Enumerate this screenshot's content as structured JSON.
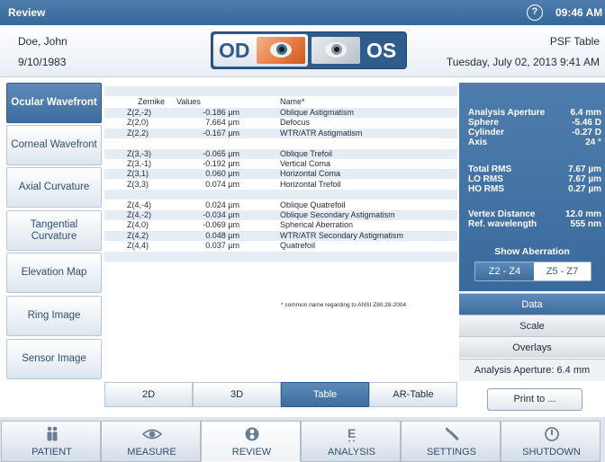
{
  "titlebar": {
    "title": "Review",
    "help_glyph": "?",
    "time": "09:46 AM"
  },
  "patient": {
    "name": "Doe, John",
    "dob": "9/10/1983"
  },
  "eye_selector": {
    "od": "OD",
    "os": "OS",
    "selected": "OD"
  },
  "view": {
    "name": "PSF Table",
    "timestamp": "Tuesday, July 02, 2013 9:41 AM"
  },
  "left_nav": {
    "active": "Ocular Wavefront",
    "items": [
      {
        "label": "Ocular Wavefront"
      },
      {
        "label": "Corneal Wavefront"
      },
      {
        "label": "Axial Curvature"
      },
      {
        "label": "Tangential Curvature"
      },
      {
        "label": "Elevation Map"
      },
      {
        "label": "Ring Image"
      },
      {
        "label": "Sensor Image"
      }
    ]
  },
  "table": {
    "headers": [
      "Zernike",
      "Values",
      "Name*"
    ],
    "rows": [
      [
        "Z(2,-2)",
        "-0.186 µm",
        "Oblique Astigmatism"
      ],
      [
        "Z(2,0)",
        "7.664 µm",
        "Defocus"
      ],
      [
        "Z(2,2)",
        "-0.167 µm",
        "WTR/ATR Astigmatism"
      ],
      [
        "",
        "",
        ""
      ],
      [
        "Z(3,-3)",
        "-0.065 µm",
        "Oblique Trefoil"
      ],
      [
        "Z(3,-1)",
        "-0.192 µm",
        "Vertical Coma"
      ],
      [
        "Z(3,1)",
        "0.060 µm",
        "Horizontal Coma"
      ],
      [
        "Z(3,3)",
        "0.074 µm",
        "Horizontal Trefoil"
      ],
      [
        "",
        "",
        ""
      ],
      [
        "Z(4,-4)",
        "0.024 µm",
        "Oblique Quatrefoil"
      ],
      [
        "Z(4,-2)",
        "-0.034 µm",
        "Oblique Secondary Astigmatism"
      ],
      [
        "Z(4,0)",
        "-0.069 µm",
        "Spherical Aberration"
      ],
      [
        "Z(4,2)",
        "0.048 µm",
        "WTR/ATR Secondary Astigmatism"
      ],
      [
        "Z(4,4)",
        "0.037 µm",
        "Quatrefoil"
      ]
    ],
    "footnote": "* common name regarding to ANSI Z80.28-2004"
  },
  "summary": {
    "group1": [
      {
        "k": "Analysis Aperture",
        "v": "6.4 mm"
      },
      {
        "k": "Sphere",
        "v": "-5.46 D"
      },
      {
        "k": "Cylinder",
        "v": "-0.27 D"
      },
      {
        "k": "Axis",
        "v": "24 °"
      }
    ],
    "group2": [
      {
        "k": "Total RMS",
        "v": "7.67 µm"
      },
      {
        "k": "LO RMS",
        "v": "7.67 µm"
      },
      {
        "k": "HO RMS",
        "v": "0.27 µm"
      }
    ],
    "group3": [
      {
        "k": "Vertex Distance",
        "v": "12.0 mm"
      },
      {
        "k": "Ref. wavelength",
        "v": "555 nm"
      }
    ],
    "show_aberration": "Show Aberration",
    "ranges": [
      "Z2 - Z4",
      "Z5 - Z7"
    ],
    "range_selected": "Z2 - Z4"
  },
  "right_buttons": {
    "data": "Data",
    "scale": "Scale",
    "overlays": "Overlays"
  },
  "aperture_footer": "Analysis Aperture: 6.4 mm",
  "view_tabs": {
    "items": [
      "2D",
      "3D",
      "Table",
      "AR-Table"
    ],
    "active": "Table"
  },
  "print_button": "Print to ...",
  "footer": {
    "active": "REVIEW",
    "items": [
      {
        "label": "PATIENT",
        "icon": "patient-icon"
      },
      {
        "label": "MEASURE",
        "icon": "eye-icon"
      },
      {
        "label": "REVIEW",
        "icon": "review-icon"
      },
      {
        "label": "ANALYSIS",
        "icon": "analysis-icon"
      },
      {
        "label": "SETTINGS",
        "icon": "wrench-icon"
      },
      {
        "label": "SHUTDOWN",
        "icon": "power-icon"
      }
    ]
  },
  "colors": {
    "accent": "#3e6d9f",
    "active_tab": "#4e7dad",
    "row_stripe": "#e4ecf4"
  }
}
